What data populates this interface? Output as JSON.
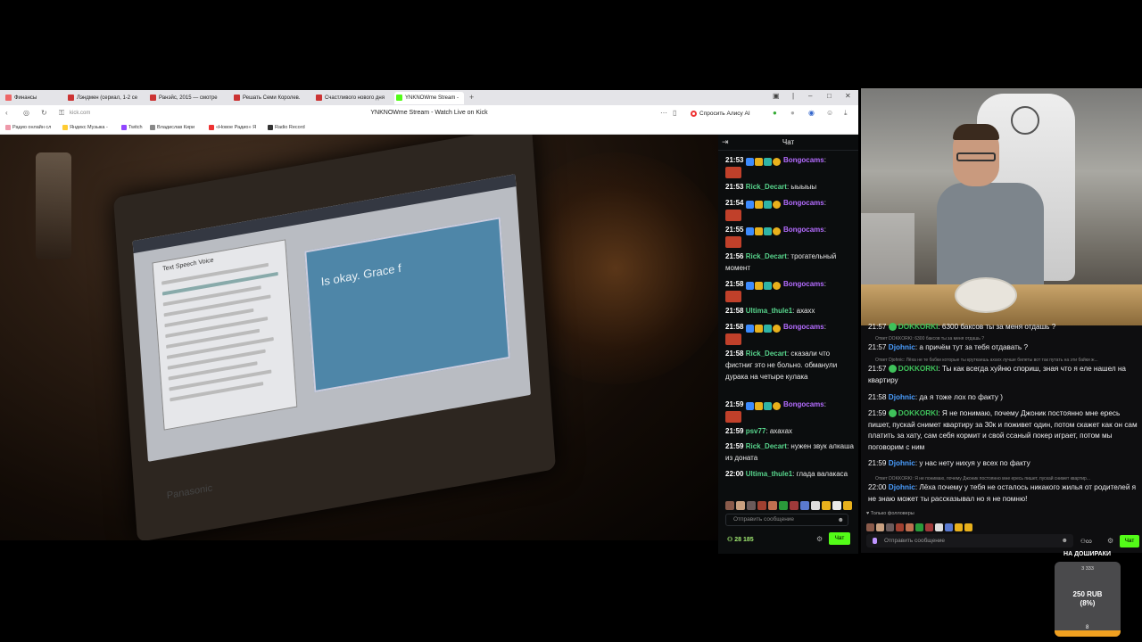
{
  "browser": {
    "tabs": [
      {
        "label": "Финансы",
        "active": false,
        "color": "#e66"
      },
      {
        "label": "Лэндмен (сериал, 1-2 се",
        "active": false,
        "color": "#c33"
      },
      {
        "label": "Ранэйс, 2015 — смотре",
        "active": false,
        "color": "#c33"
      },
      {
        "label": "Решать Семи Королев.",
        "active": false,
        "color": "#c33"
      },
      {
        "label": "Счастливого нового дня",
        "active": false,
        "color": "#c33"
      },
      {
        "label": "YNKNOWme Stream -",
        "active": true,
        "color": "#53fc18"
      }
    ],
    "url": "kick.com",
    "page_title": "YNKNOWme Stream - Watch Live on Kick",
    "alice_label": "Спросить Алису AI",
    "bookmarks": [
      {
        "label": "Радио онлайн сл",
        "color": "#e9a"
      },
      {
        "label": "Яндекс Музыка -",
        "color": "#fc3"
      },
      {
        "label": "Twitch",
        "color": "#9146ff"
      },
      {
        "label": "Владислав Кири",
        "color": "#888"
      },
      {
        "label": "«Новое Радио» Я",
        "color": "#e33"
      },
      {
        "label": "Radio Record",
        "color": "#333"
      }
    ]
  },
  "video": {
    "screen_text": "Is okay. Grace f",
    "dialog_title": "Text Speech Voice",
    "laptop_brand": "Panasonic"
  },
  "kick_chat": {
    "title": "Чат",
    "messages": [
      {
        "time": "21:53",
        "user": "Bongocams",
        "color": "#b46cff",
        "text": "",
        "badges": true,
        "avatar": true
      },
      {
        "time": "21:53",
        "user": "Rick_Decart",
        "color": "#58d68d",
        "text": "ыыыыы"
      },
      {
        "time": "21:54",
        "user": "Bongocams",
        "color": "#b46cff",
        "text": "",
        "badges": true,
        "avatar": true
      },
      {
        "time": "21:55",
        "user": "Bongocams",
        "color": "#b46cff",
        "text": "",
        "badges": true,
        "avatar": true
      },
      {
        "time": "21:56",
        "user": "Rick_Decart",
        "color": "#58d68d",
        "text": "трогательный момент"
      },
      {
        "time": "21:58",
        "user": "Bongocams",
        "color": "#b46cff",
        "text": "",
        "badges": true,
        "avatar": true
      },
      {
        "time": "21:58",
        "user": "Ultima_thule1",
        "color": "#58d68d",
        "text": "ахахх"
      },
      {
        "time": "21:58",
        "user": "Bongocams",
        "color": "#b46cff",
        "text": "",
        "badges": true,
        "avatar": true
      },
      {
        "time": "21:58",
        "user": "Rick_Decart",
        "color": "#58d68d",
        "text": "сказали что фистниг это не больно. обманули дурака на четыре кулака"
      },
      {
        "time": "21:59",
        "user": "Bongocams",
        "color": "#b46cff",
        "text": "",
        "badges": true,
        "avatar": true
      },
      {
        "time": "21:59",
        "user": "psv77",
        "color": "#58d68d",
        "text": "ахахах"
      },
      {
        "time": "21:59",
        "user": "Rick_Decart",
        "color": "#58d68d",
        "text": "нужен звук алкаша из доната"
      },
      {
        "time": "22:00",
        "user": "Ultima_thule1",
        "color": "#58d68d",
        "text": "глада валакаса"
      }
    ],
    "input_placeholder": "Отправить сообщение",
    "viewers": "28 185",
    "chat_button": "Чат"
  },
  "twitch_chat": {
    "messages": [
      {
        "time": "21:57",
        "user": "DOKKORKI",
        "color": "#3fc25b",
        "text": "6300 баксов ты за меня отдашь ?",
        "badge": true
      },
      {
        "reply": "Ответ DOKKORKI: 6300 баксов ты за меня отдашь ?"
      },
      {
        "time": "21:57",
        "user": "Djohnic",
        "color": "#4a9eff",
        "text": "а причём тут за тебя отдавать ?"
      },
      {
        "reply": "Ответ Djohnic: Лёха не те бабки которые ты круткаешь ахахх лучше билеты вот так путать на эти байки ж..."
      },
      {
        "time": "21:57",
        "user": "DOKKORKI",
        "color": "#3fc25b",
        "text": "Ты как всегда хуйню спориш, зная что я еле нашел на квартиру",
        "badge": true
      },
      {
        "time": "21:58",
        "user": "Djohnic",
        "color": "#4a9eff",
        "text": "да я тоже лох по факту )"
      },
      {
        "time": "21:59",
        "user": "DOKKORKI",
        "color": "#3fc25b",
        "text": "Я не понимаю, почему Джоник постоянно мне ересь пишет, пускай снимет квартиру за 30к и поживет один, потом скажет как он сам платить за хату, сам себя кормит и свой ссаный покер играет, потом мы поговорим с ним",
        "badge": true
      },
      {
        "time": "21:59",
        "user": "Djohnic",
        "color": "#4a9eff",
        "text": "у нас нету нихуя у всех по факту"
      },
      {
        "reply": "Ответ DOKKORKI: Я не понимаю, почему Джоник постоянно мне ересь пишет, пускай снимет квартир..."
      },
      {
        "time": "22:00",
        "user": "Djohnic",
        "color": "#4a9eff",
        "text": "Лёха почему у тебя не осталось никакого жилья от родителей я не знаю может ты рассказывал но я не помню!"
      }
    ],
    "followers_only": "Только фолловеры",
    "input_placeholder": "Отправить сообщение",
    "viewers": "co",
    "chat_button": "Чат"
  },
  "donation_goal": {
    "title": "НА ДОШИРАКИ",
    "count": "3 333",
    "amount_line1": "250 RUB",
    "amount_line2": "(8%)",
    "progress_fraction": 0.08,
    "marker": "8"
  }
}
